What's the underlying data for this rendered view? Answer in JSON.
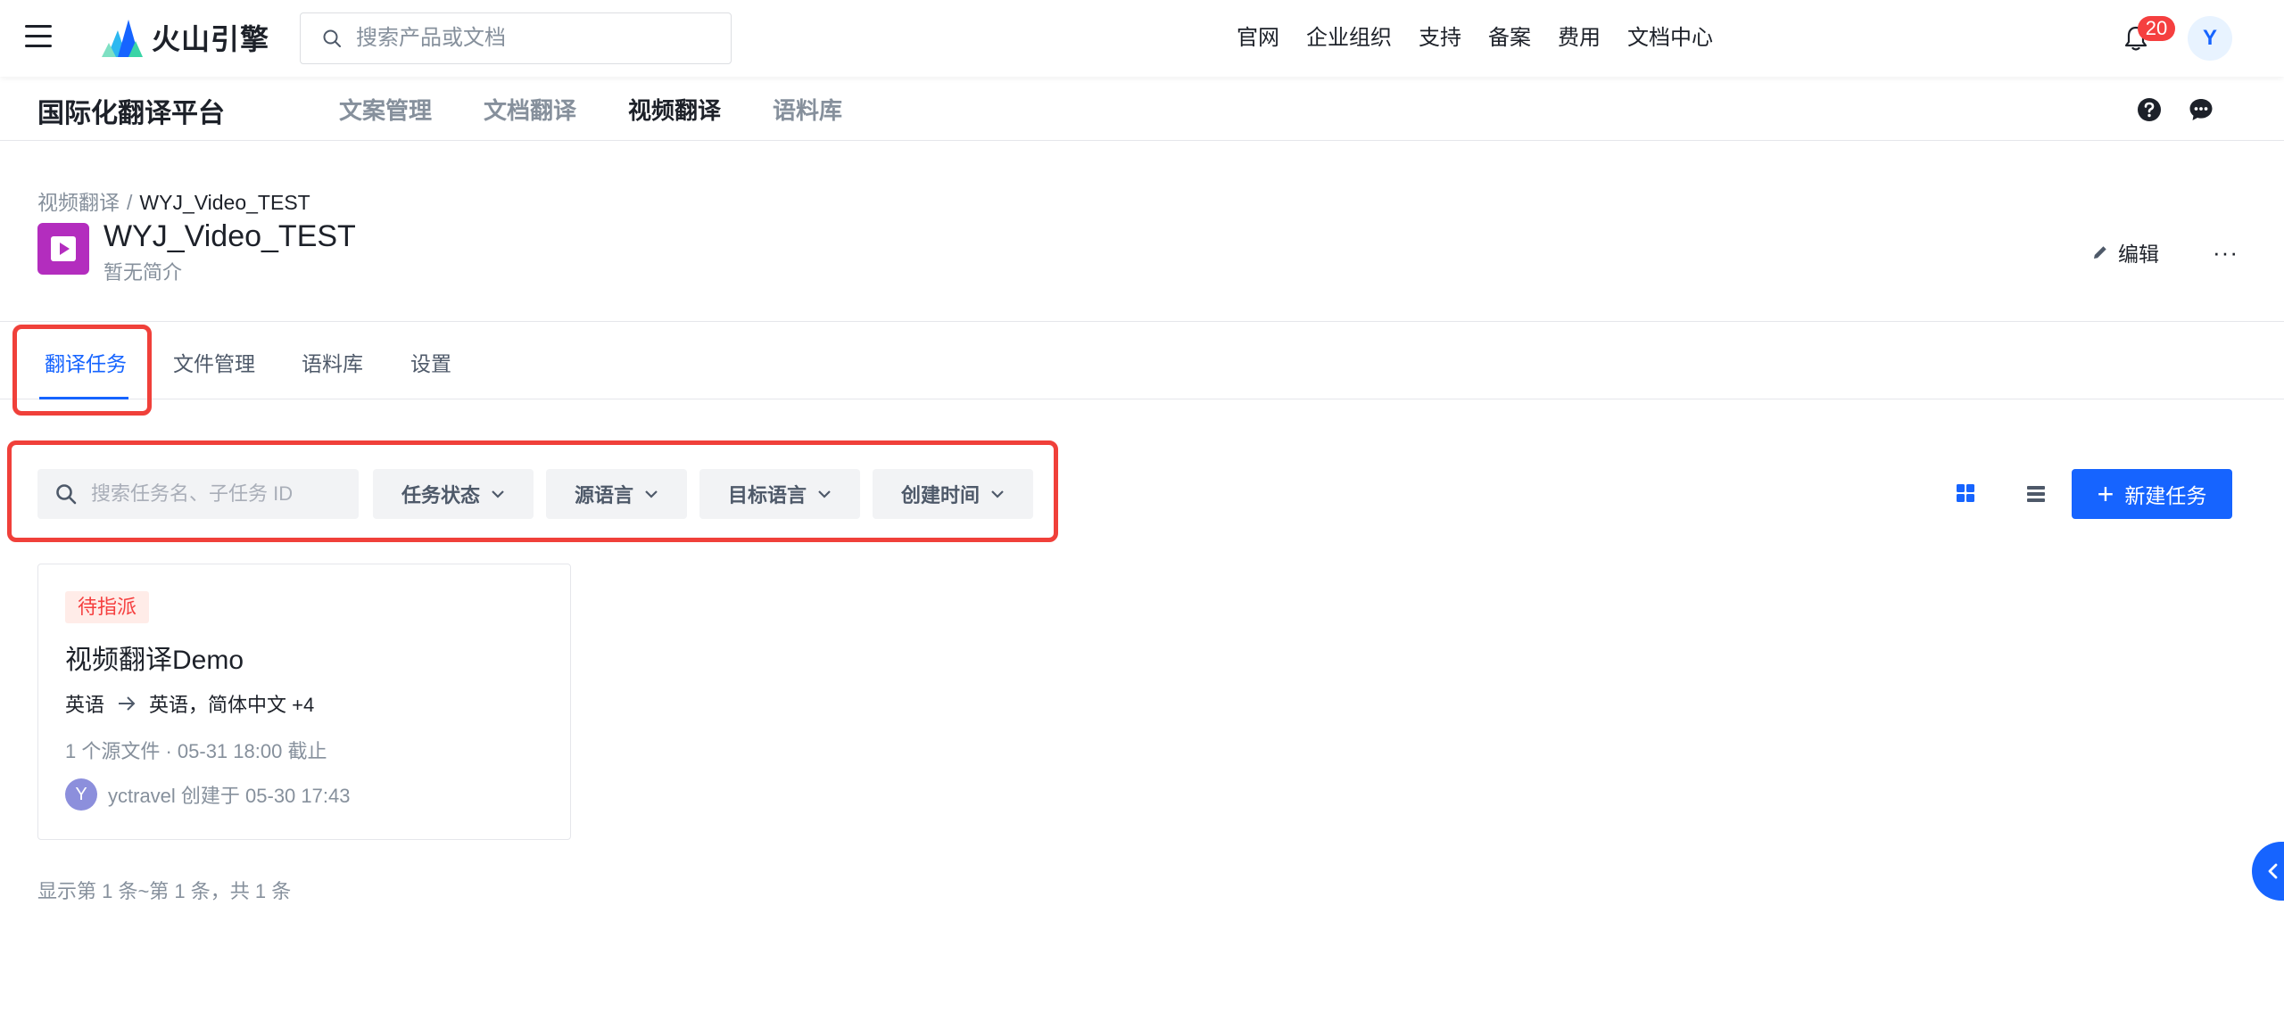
{
  "header": {
    "logo_text": "火山引擎",
    "search_placeholder": "搜索产品或文档",
    "links": [
      "官网",
      "企业组织",
      "支持",
      "备案",
      "费用",
      "文档中心"
    ],
    "notification_count": "20",
    "avatar_letter": "Y"
  },
  "subnav": {
    "platform_title": "国际化翻译平台",
    "tabs": [
      "文案管理",
      "文档翻译",
      "视频翻译",
      "语料库"
    ],
    "active_tab": "视频翻译"
  },
  "page": {
    "breadcrumb": [
      "视频翻译",
      "WYJ_Video_TEST"
    ],
    "breadcrumb_sep": "/",
    "project_name": "WYJ_Video_TEST",
    "project_desc": "暂无简介",
    "edit_label": "编辑",
    "more_label": "···"
  },
  "tabs": {
    "items": [
      "翻译任务",
      "文件管理",
      "语料库",
      "设置"
    ],
    "active": "翻译任务"
  },
  "filters": {
    "search_placeholder": "搜索任务名、子任务 ID",
    "status": "任务状态",
    "source_lang": "源语言",
    "target_lang": "目标语言",
    "created_time": "创建时间",
    "new_task_label": "新建任务"
  },
  "tasks": [
    {
      "status": "待指派",
      "name": "视频翻译Demo",
      "source_lang": "英语",
      "target_langs": "英语，简体中文 +4",
      "meta": "1 个源文件 · 05-31 18:00 截止",
      "creator_initial": "Y",
      "creator_text": "yctravel 创建于 05-30 17:43"
    }
  ],
  "pagination": "显示第 1 条~第 1 条，共 1 条",
  "colors": {
    "primary": "#1664ff",
    "highlight": "#f0403a",
    "project_icon": "#b32dbe",
    "status_tag_bg": "#ffece8",
    "status_tag_text": "#f53f3f"
  }
}
